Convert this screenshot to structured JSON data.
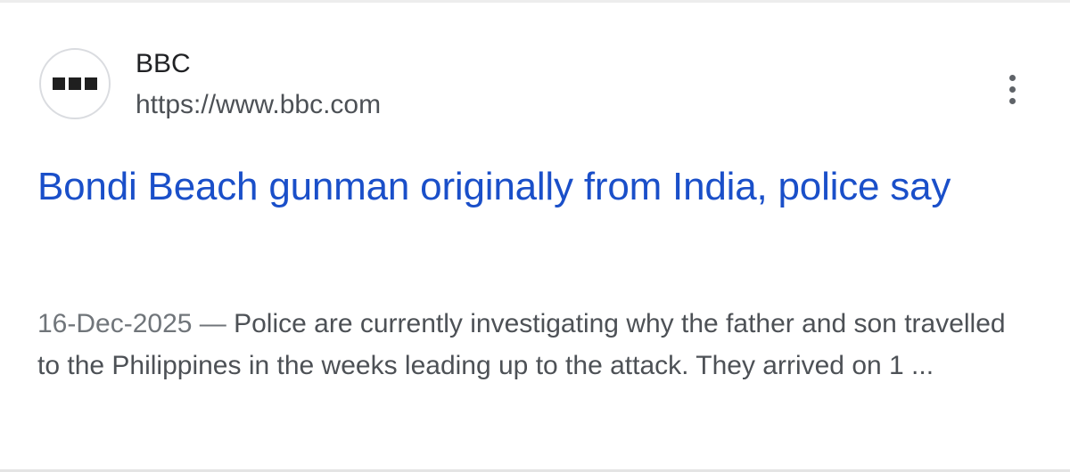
{
  "result": {
    "favicon_icon": "bbc-logo-icon",
    "site_name": "BBC",
    "site_url": "https://www.bbc.com",
    "more_icon": "more-vertical-icon",
    "title": "Bondi Beach gunman originally from India, police say",
    "date": "16-Dec-2025",
    "separator": " — ",
    "snippet": "Police are currently investigating why the father and son travelled to the Philippines in the weeks leading up to the attack. They arrived on 1 ..."
  },
  "colors": {
    "title_link": "#1a4fc9",
    "site_name": "#202124",
    "url": "#4d5156",
    "snippet": "#4d5156"
  }
}
